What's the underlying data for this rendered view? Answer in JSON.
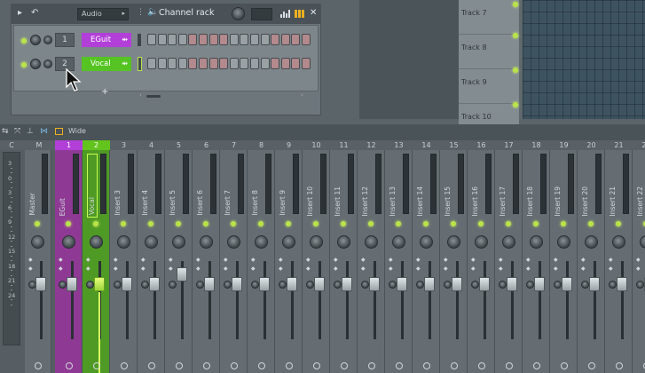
{
  "rack": {
    "pattern": "Audio",
    "title": "Channel rack",
    "channels": [
      {
        "number": "1",
        "name": "EGuit",
        "color": "#b23fd8"
      },
      {
        "number": "2",
        "name": "Vocal",
        "color": "#55c423"
      }
    ],
    "add_label": "+"
  },
  "playlist": {
    "tracks": [
      "Track 7",
      "Track 8",
      "Track 9",
      "Track 10"
    ]
  },
  "mixer": {
    "view_label": "Wide",
    "scale": [
      "3",
      "0",
      "3",
      "6",
      "9",
      "12",
      "15",
      "18",
      "21",
      "24"
    ],
    "col_headers": [
      "C",
      "M",
      "1",
      "2",
      "3",
      "4",
      "5",
      "6",
      "7",
      "8",
      "9",
      "10",
      "11",
      "12",
      "13",
      "14",
      "15",
      "16",
      "17",
      "18",
      "19",
      "20",
      "21",
      "22"
    ],
    "strips": [
      "Master",
      "EGuit",
      "Vocal",
      "Insert 3",
      "Insert 4",
      "Insert 5",
      "Insert 6",
      "Insert 7",
      "Insert 8",
      "Insert 9",
      "Insert 10",
      "Insert 11",
      "Insert 12",
      "Insert 13",
      "Insert 14",
      "Insert 15",
      "Insert 16",
      "Insert 17",
      "Insert 18",
      "Insert 19",
      "Insert 20",
      "Insert 21",
      "Insert 22"
    ],
    "colors": {
      "eguit": "#9a3aa0",
      "vocal": "#5aa423",
      "vocal_head": "#63c41d"
    }
  }
}
